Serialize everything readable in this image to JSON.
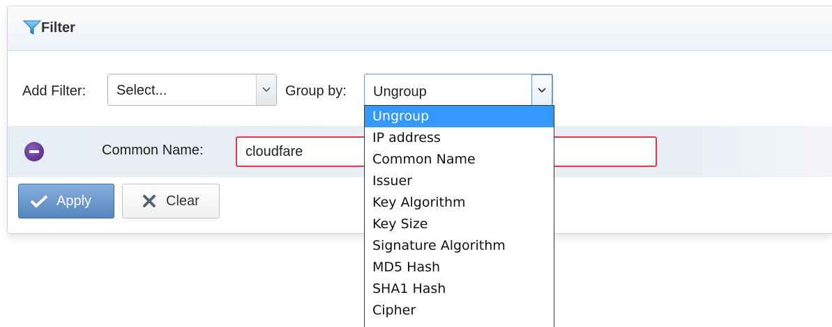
{
  "panel": {
    "title": "Filter",
    "icon": "funnel-icon"
  },
  "toolbar": {
    "add_filter_label": "Add Filter:",
    "add_filter_value": "Select...",
    "group_by_label": "Group by:",
    "group_by_value": "Ungroup"
  },
  "filter_row": {
    "label": "Common Name:",
    "value": "cloudfare",
    "remove_icon": "minus-circle-icon"
  },
  "buttons": {
    "apply_label": "Apply",
    "clear_label": "Clear"
  },
  "group_by_options": [
    "Ungroup",
    "IP address",
    "Common Name",
    "Issuer",
    "Key Algorithm",
    "Key Size",
    "Signature Algorithm",
    "MD5 Hash",
    "SHA1 Hash",
    "Cipher"
  ],
  "colors": {
    "accent": "#3399ff",
    "error_border": "#e0394a",
    "apply_button": "#5586bf",
    "remove_icon": "#5a2d8a"
  }
}
